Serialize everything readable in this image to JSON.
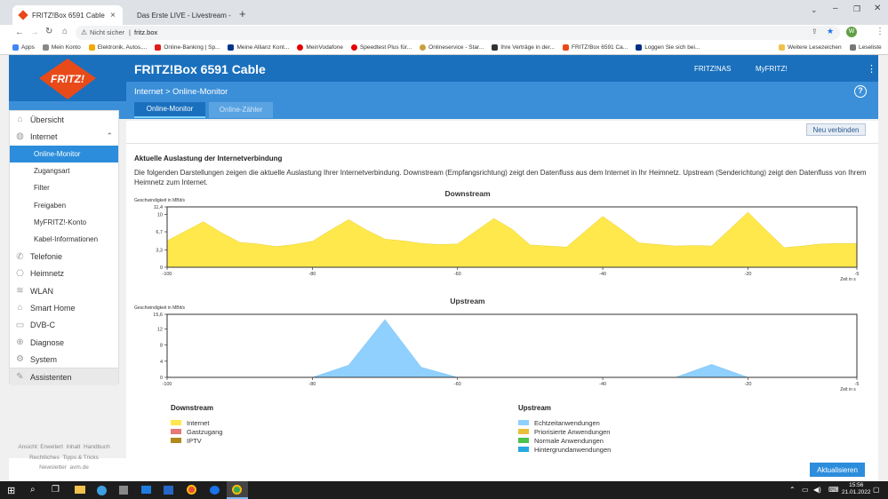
{
  "browser": {
    "tabs": [
      {
        "title": "FRITZ!Box 6591 Cable"
      },
      {
        "title": "Das Erste LIVE - Livestream -"
      }
    ],
    "address_prefix": "Nicht sicher",
    "url": "fritz.box",
    "profile_letter": "W",
    "bookmarks": [
      "Apps",
      "Mein Konto",
      "Elektronik, Autos,...",
      "Online-Banking | Sp...",
      "Meine Allianz Kont...",
      "MeinVodafone",
      "Speedtest Plus für...",
      "Onlineservice - Star...",
      "Ihre Verträge in der...",
      "FRITZ!Box 6591 Ca...",
      "Loggen Sie sich bei..."
    ],
    "bookmarks_right": [
      "Weitere Lesezeichen",
      "Leseliste"
    ]
  },
  "colors": {
    "fritz_blue": "#1a70bd",
    "fritz_light_blue": "#3b8fd8",
    "internet": "#ffe84c",
    "upstream_realtime": "#8fd0ff",
    "prioritized": "#e8c038",
    "normal": "#4cc24c",
    "background": "#26a8e0",
    "guest": "#e87878",
    "iptv": "#b08a1c"
  },
  "header": {
    "logo_text": "FRITZ!",
    "product": "FRITZ!Box 6591 Cable",
    "nav": [
      "FRITZ!NAS",
      "MyFRITZ!"
    ],
    "breadcrumb_1": "Internet",
    "breadcrumb_sep": ">",
    "breadcrumb_2": "Online-Monitor",
    "help": "?",
    "tabs": [
      "Online-Monitor",
      "Online-Zähler"
    ]
  },
  "sidebar": {
    "items": [
      {
        "label": "Übersicht",
        "icon": "home-icon"
      },
      {
        "label": "Internet",
        "icon": "globe-icon",
        "expanded": true
      },
      {
        "label": "Online-Monitor",
        "sub": true,
        "selected": true
      },
      {
        "label": "Zugangsart",
        "sub": true
      },
      {
        "label": "Filter",
        "sub": true
      },
      {
        "label": "Freigaben",
        "sub": true
      },
      {
        "label": "MyFRITZ!-Konto",
        "sub": true
      },
      {
        "label": "Kabel-Informationen",
        "sub": true
      },
      {
        "label": "Telefonie",
        "icon": "phone-icon"
      },
      {
        "label": "Heimnetz",
        "icon": "network-icon"
      },
      {
        "label": "WLAN",
        "icon": "wifi-icon"
      },
      {
        "label": "Smart Home",
        "icon": "smarthome-icon"
      },
      {
        "label": "DVB-C",
        "icon": "tv-icon"
      },
      {
        "label": "Diagnose",
        "icon": "diagnose-icon"
      },
      {
        "label": "System",
        "icon": "system-icon"
      },
      {
        "label": "Assistenten",
        "icon": "wizard-icon"
      }
    ],
    "footer_line1": [
      "Ansicht: Erweitert",
      "Inhalt",
      "Handbuch"
    ],
    "footer_line2": [
      "Rechtliches",
      "Tipps & Tricks"
    ],
    "footer_line3": [
      "Newsletter",
      "avm.de"
    ]
  },
  "content": {
    "reconnect_button": "Neu verbinden",
    "heading": "Aktuelle Auslastung der Internetverbindung",
    "description": "Die folgenden Darstellungen zeigen die aktuelle Auslastung Ihrer Internetverbindung. Downstream (Empfangsrichtung) zeigt den Datenfluss aus dem Internet in Ihr Heimnetz. Upstream (Senderichtung) zeigt den Datenfluss von Ihrem Heimnetz zum Internet.",
    "refresh_button": "Aktualisieren",
    "legend_down_title": "Downstream",
    "legend_down": [
      "Internet",
      "Gastzugang",
      "IPTV"
    ],
    "legend_up_title": "Upstream",
    "legend_up": [
      "Echtzeitanwendungen",
      "Priorisierte Anwendungen",
      "Normale Anwendungen",
      "Hintergrundanwendungen"
    ]
  },
  "chart_data": [
    {
      "type": "area",
      "title": "Downstream",
      "ylabel": "Geschwindigkeit in MBit/s",
      "xlabel": "Zeit in s",
      "ylim": [
        0,
        11.4
      ],
      "yticks": [
        "0",
        "3,3",
        "6,7",
        "10",
        "11,4"
      ],
      "xticks": [
        "-100",
        "-80",
        "-60",
        "-40",
        "-20",
        "-5"
      ],
      "xlim": [
        -100,
        -5
      ],
      "series": [
        {
          "name": "Internet",
          "x": [
            -100,
            -97.5,
            -95,
            -92.5,
            -90,
            -87.5,
            -85,
            -82.5,
            -80,
            -77.5,
            -75,
            -72.5,
            -70,
            -67.5,
            -65,
            -62.5,
            -60,
            -57.5,
            -55,
            -52.5,
            -50,
            -47.5,
            -45,
            -42.5,
            -40,
            -37.5,
            -35,
            -32.5,
            -30,
            -27.5,
            -25,
            -22.5,
            -20,
            -17.5,
            -15,
            -12.5,
            -10,
            -7.5,
            -5
          ],
          "values": [
            5.0,
            6.8,
            8.6,
            6.5,
            4.7,
            4.4,
            3.9,
            4.3,
            4.9,
            7.0,
            9.0,
            7.0,
            5.3,
            5.0,
            4.5,
            4.3,
            4.4,
            6.8,
            9.2,
            7.2,
            4.2,
            4.0,
            3.8,
            6.7,
            9.6,
            7.2,
            4.6,
            4.3,
            4.0,
            4.1,
            4.0,
            7.2,
            10.4,
            7.0,
            3.7,
            4.0,
            4.4,
            4.5,
            4.5
          ]
        }
      ]
    },
    {
      "type": "area",
      "title": "Upstream",
      "ylabel": "Geschwindigkeit in MBit/s",
      "xlabel": "Zeit in s",
      "ylim": [
        0,
        15.6
      ],
      "yticks": [
        "0",
        "4",
        "8",
        "12",
        "15,6"
      ],
      "xticks": [
        "-100",
        "-80",
        "-60",
        "-40",
        "-20",
        "-5"
      ],
      "xlim": [
        -100,
        -5
      ],
      "series": [
        {
          "name": "Echtzeitanwendungen",
          "x": [
            -100,
            -95,
            -90,
            -85,
            -80,
            -75,
            -70,
            -65,
            -60,
            -55,
            -50,
            -45,
            -40,
            -35,
            -30,
            -25,
            -20,
            -15,
            -10,
            -5
          ],
          "values": [
            0,
            0,
            0,
            0,
            0,
            3,
            14.3,
            2.5,
            0,
            0,
            0,
            0,
            0,
            0,
            0,
            3.2,
            0,
            0,
            0,
            0
          ]
        }
      ]
    }
  ]
}
